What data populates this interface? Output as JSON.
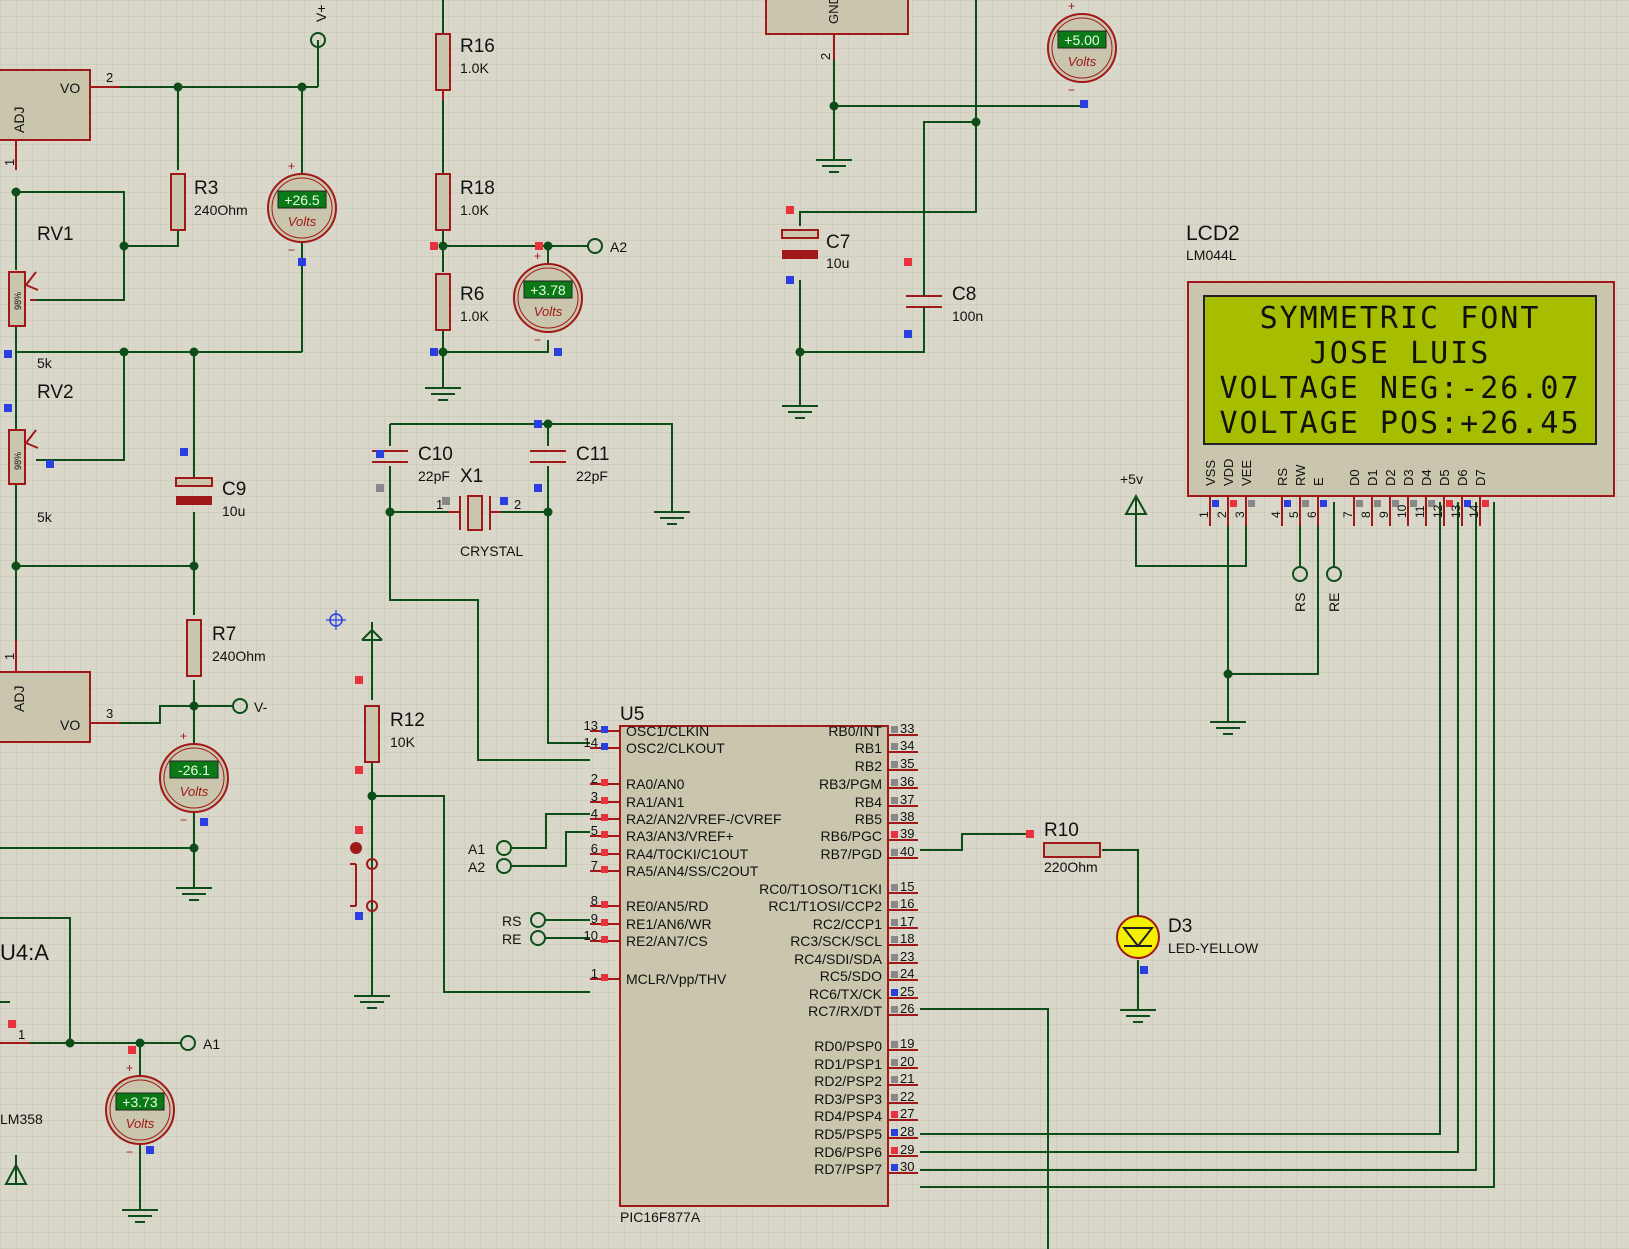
{
  "components": {
    "R16": {
      "ref": "R16",
      "value": "1.0K"
    },
    "R18": {
      "ref": "R18",
      "value": "1.0K"
    },
    "R6": {
      "ref": "R6",
      "value": "1.0K"
    },
    "R3": {
      "ref": "R3",
      "value": "240Ohm"
    },
    "R7": {
      "ref": "R7",
      "value": "240Ohm"
    },
    "R12": {
      "ref": "R12",
      "value": "10K"
    },
    "R10": {
      "ref": "R10",
      "value": "220Ohm"
    },
    "RV1": {
      "ref": "RV1",
      "value": "5k",
      "pct": "98%"
    },
    "RV2": {
      "ref": "RV2",
      "value": "5k",
      "pct": "98%"
    },
    "C7": {
      "ref": "C7",
      "value": "10u"
    },
    "C8": {
      "ref": "C8",
      "value": "100n"
    },
    "C9": {
      "ref": "C9",
      "value": "10u"
    },
    "C10": {
      "ref": "C10",
      "value": "22pF"
    },
    "C11": {
      "ref": "C11",
      "value": "22pF"
    },
    "X1": {
      "ref": "X1",
      "value": "CRYSTAL"
    },
    "D3": {
      "ref": "D3",
      "value": "LED-YELLOW"
    },
    "U4": {
      "ref": "U4:A",
      "value": "LM358"
    },
    "U5": {
      "ref": "U5",
      "value": "PIC16F877A"
    },
    "LCD2": {
      "ref": "LCD2",
      "value": "LM044L"
    }
  },
  "regulators": {
    "adj": "ADJ",
    "vo": "VO",
    "gnd": "GND",
    "pin1": "1",
    "pin2": "2",
    "pin3": "3"
  },
  "voltmeters": [
    {
      "reading": "+26.5",
      "unit": "Volts"
    },
    {
      "reading": "+3.78",
      "unit": "Volts"
    },
    {
      "reading": "+5.00",
      "unit": "Volts"
    },
    {
      "reading": "-26.1",
      "unit": "Volts"
    },
    {
      "reading": "+3.73",
      "unit": "Volts"
    }
  ],
  "terminals": {
    "vplus": "V+",
    "vminus": "V-",
    "a1": "A1",
    "a2": "A2",
    "rs": "RS",
    "re": "RE",
    "plus5v": "+5v"
  },
  "lcd": {
    "lines": [
      "SYMMETRIC FONT",
      "JOSE LUIS",
      "VOLTAGE NEG:-26.07",
      "VOLTAGE POS:+26.45"
    ],
    "pins": [
      "VSS",
      "VDD",
      "VEE",
      "RS",
      "RW",
      "E",
      "D0",
      "D1",
      "D2",
      "D3",
      "D4",
      "D5",
      "D6",
      "D7"
    ],
    "pin_numbers": [
      "1",
      "2",
      "3",
      "4",
      "5",
      "6",
      "7",
      "8",
      "9",
      "10",
      "11",
      "12",
      "13",
      "14"
    ]
  },
  "mcu": {
    "left_pins": [
      {
        "num": "13",
        "name": "OSC1/CLKIN"
      },
      {
        "num": "14",
        "name": "OSC2/CLKOUT"
      },
      {
        "num": "2",
        "name": "RA0/AN0"
      },
      {
        "num": "3",
        "name": "RA1/AN1"
      },
      {
        "num": "4",
        "name": "RA2/AN2/VREF-/CVREF"
      },
      {
        "num": "5",
        "name": "RA3/AN3/VREF+"
      },
      {
        "num": "6",
        "name": "RA4/T0CKI/C1OUT"
      },
      {
        "num": "7",
        "name": "RA5/AN4/SS/C2OUT"
      },
      {
        "num": "8",
        "name": "RE0/AN5/RD"
      },
      {
        "num": "9",
        "name": "RE1/AN6/WR"
      },
      {
        "num": "10",
        "name": "RE2/AN7/CS"
      },
      {
        "num": "1",
        "name": "MCLR/Vpp/THV"
      }
    ],
    "right_pins": [
      {
        "num": "33",
        "name": "RB0/INT"
      },
      {
        "num": "34",
        "name": "RB1"
      },
      {
        "num": "35",
        "name": "RB2"
      },
      {
        "num": "36",
        "name": "RB3/PGM"
      },
      {
        "num": "37",
        "name": "RB4"
      },
      {
        "num": "38",
        "name": "RB5"
      },
      {
        "num": "39",
        "name": "RB6/PGC"
      },
      {
        "num": "40",
        "name": "RB7/PGD"
      },
      {
        "num": "15",
        "name": "RC0/T1OSO/T1CKI"
      },
      {
        "num": "16",
        "name": "RC1/T1OSI/CCP2"
      },
      {
        "num": "17",
        "name": "RC2/CCP1"
      },
      {
        "num": "18",
        "name": "RC3/SCK/SCL"
      },
      {
        "num": "23",
        "name": "RC4/SDI/SDA"
      },
      {
        "num": "24",
        "name": "RC5/SDO"
      },
      {
        "num": "25",
        "name": "RC6/TX/CK"
      },
      {
        "num": "26",
        "name": "RC7/RX/DT"
      },
      {
        "num": "19",
        "name": "RD0/PSP0"
      },
      {
        "num": "20",
        "name": "RD1/PSP1"
      },
      {
        "num": "21",
        "name": "RD2/PSP2"
      },
      {
        "num": "22",
        "name": "RD3/PSP3"
      },
      {
        "num": "27",
        "name": "RD4/PSP4"
      },
      {
        "num": "28",
        "name": "RD5/PSP5"
      },
      {
        "num": "29",
        "name": "RD6/PSP6"
      },
      {
        "num": "30",
        "name": "RD7/PSP7"
      }
    ]
  },
  "pin_labels": {
    "x1_1": "1",
    "x1_2": "2",
    "u4_1": "1",
    "c2": "2"
  },
  "colors": {
    "wire": "#0d4d17",
    "part_outline": "#a01818",
    "part_fill": "#c9c6ad",
    "background": "#d8d7c9",
    "lcd_screen": "#a7bd00",
    "meter_display": "#0b7a16",
    "pin_red": "#e8323c",
    "pin_blue": "#2a3fe0"
  }
}
